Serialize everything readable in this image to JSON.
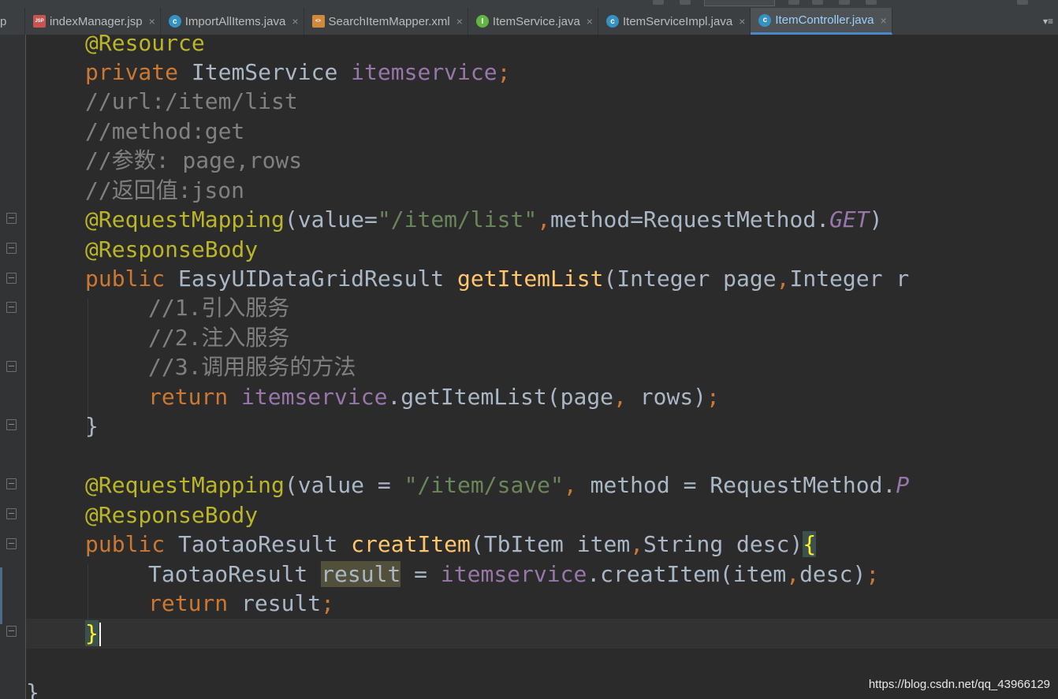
{
  "tabs": [
    {
      "name": "indexManager.jsp",
      "icon": "jsp-file-icon",
      "icon_text": "JSP",
      "active": false
    },
    {
      "name": "ImportAllItems.java",
      "icon": "class-icon",
      "icon_text": "c",
      "active": false
    },
    {
      "name": "SearchItemMapper.xml",
      "icon": "xml-file-icon",
      "icon_text": "<>",
      "active": false
    },
    {
      "name": "ItemService.java",
      "icon": "interface-icon",
      "icon_text": "I",
      "active": false
    },
    {
      "name": "ItemServiceImpl.java",
      "icon": "class-icon",
      "icon_text": "c",
      "active": false
    },
    {
      "name": "ItemController.java",
      "icon": "class-icon",
      "icon_text": "c",
      "active": true
    }
  ],
  "tab_left_fragment": "p",
  "close_glyph": "×",
  "overflow_glyph": "▾≡",
  "code": {
    "l1_ann": "@Resource",
    "l2_kw": "private",
    "l2_type": "ItemService",
    "l2_field": "itemservice",
    "l2_semi": ";",
    "l3": "//url:/item/list",
    "l4": "//method:get",
    "l5": "//参数: page,rows",
    "l6": "//返回值:json",
    "l7_ann": "@RequestMapping",
    "l7_a": "(value=",
    "l7_str": "\"/item/list\"",
    "l7_comma": ",",
    "l7_b": "method=RequestMethod.",
    "l7_const": "GET",
    "l7_c": ")",
    "l8_ann": "@ResponseBody",
    "l9_kw": "public",
    "l9_type": "EasyUIDataGridResult",
    "l9_method": "getItemList",
    "l9_a": "(Integer page",
    "l9_comma": ",",
    "l9_b": "Integer r",
    "l10": "//1.引入服务",
    "l11": "//2.注入服务",
    "l12": "//3.调用服务的方法",
    "l13_kw": "return",
    "l13_field": "itemservice",
    "l13_a": ".getItemList(page",
    "l13_comma": ",",
    "l13_b": " rows)",
    "l13_semi": ";",
    "l14": "}",
    "l16_ann": "@RequestMapping",
    "l16_a": "(value = ",
    "l16_str": "\"/item/save\"",
    "l16_comma": ",",
    "l16_b": " method = RequestMethod.",
    "l16_const": "P",
    "l17_ann": "@ResponseBody",
    "l18_kw": "public",
    "l18_type": "TaotaoResult",
    "l18_method": "creatItem",
    "l18_a": "(TbItem item",
    "l18_comma": ",",
    "l18_b": "String desc)",
    "l18_brace": "{",
    "l19_type": "TaotaoResult",
    "l19_var": "result",
    "l19_eq": " = ",
    "l19_field": "itemservice",
    "l19_a": ".creatItem(item",
    "l19_comma": ",",
    "l19_b": "desc)",
    "l19_semi": ";",
    "l20_kw": "return",
    "l20_a": " result",
    "l20_semi": ";",
    "l21_brace": "}",
    "l23": "}"
  },
  "watermark": "https://blog.csdn.net/qq_43966129",
  "colors": {
    "background": "#2b2b2b",
    "keyword": "#cc7832",
    "annotation": "#bbb529",
    "field": "#9876aa",
    "string": "#6a8759",
    "comment": "#808080",
    "method": "#ffc66d",
    "plain": "#a9b7c6",
    "active_tab_text": "#9bd1ff"
  }
}
